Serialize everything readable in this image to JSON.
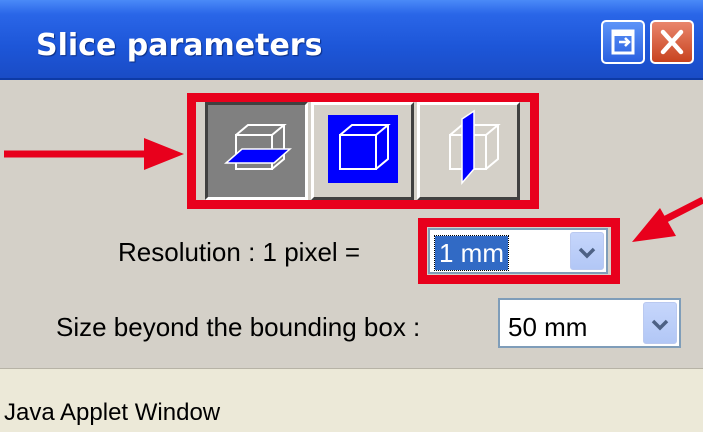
{
  "window": {
    "title": "Slice parameters",
    "restore_icon": "restore-icon",
    "close_icon": "close-icon"
  },
  "view_buttons": [
    {
      "name": "axial-plane-view",
      "icon": "horizontal-slice-cube-icon",
      "pressed": true
    },
    {
      "name": "coronal-plane-view",
      "icon": "frontal-slice-cube-icon",
      "pressed": false
    },
    {
      "name": "sagittal-plane-view",
      "icon": "vertical-slice-cube-icon",
      "pressed": false
    }
  ],
  "resolution": {
    "label": "Resolution : 1 pixel =",
    "value": "1 mm"
  },
  "bounding_box": {
    "label": "Size beyond the bounding box :",
    "value": "50 mm"
  },
  "status": {
    "text": "Java Applet Window"
  },
  "colors": {
    "title_bar": "#1d56d8",
    "highlight": "#e8001c",
    "plane_blue": "#0000ff",
    "panel": "#d4d0c8"
  }
}
